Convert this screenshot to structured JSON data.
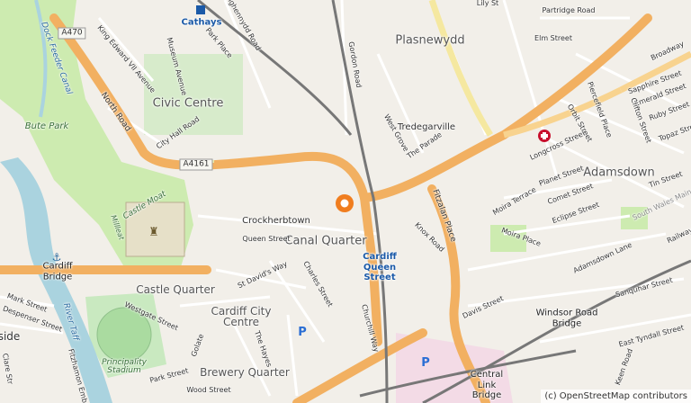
{
  "map": {
    "attribution": "(c) OpenStreetMap contributors",
    "districts": [
      {
        "key": "plasnewydd",
        "text": "Plasnewydd"
      },
      {
        "key": "civic",
        "text": "Civic Centre"
      },
      {
        "key": "adamsdown",
        "text": "Adamsdown"
      },
      {
        "key": "canal",
        "text": "Canal Quarter"
      },
      {
        "key": "castleq",
        "text": "Castle Quarter"
      },
      {
        "key": "citycentre",
        "text": "Cardiff City Centre"
      },
      {
        "key": "brewery",
        "text": "Brewery Quarter"
      },
      {
        "key": "tredegar",
        "text": "Tredegarville"
      },
      {
        "key": "crock",
        "text": "Crockherbtown"
      },
      {
        "key": "side",
        "text": "side"
      }
    ],
    "stations": [
      {
        "key": "cathays",
        "text": "Cathays"
      },
      {
        "key": "queenst",
        "text": "Cardiff Queen Street"
      }
    ],
    "bridges": [
      {
        "key": "cardiffbridge",
        "text": "Cardiff Bridge"
      },
      {
        "key": "windsor",
        "text": "Windsor Road Bridge"
      },
      {
        "key": "central",
        "text": "Central Link Bridge"
      }
    ],
    "parks": [
      {
        "key": "bute",
        "text": "Bute Park"
      },
      {
        "key": "moat",
        "text": "Castle Moat"
      },
      {
        "key": "millleat",
        "text": "Millleat"
      },
      {
        "key": "stadium",
        "text": "Principality Stadium"
      }
    ],
    "water": [
      {
        "key": "feeder",
        "text": "Dock Feeder Canal"
      },
      {
        "key": "taff",
        "text": "River Taff"
      }
    ],
    "shields": [
      {
        "key": "a470",
        "text": "A470"
      },
      {
        "key": "a4161",
        "text": "A4161"
      }
    ],
    "streets": [
      {
        "key": "senghennydd",
        "text": "Senghennydd Road"
      },
      {
        "key": "parkplace",
        "text": "Park Place"
      },
      {
        "key": "kingedward",
        "text": "King Edward VII Avenue"
      },
      {
        "key": "museum",
        "text": "Museum Avenue"
      },
      {
        "key": "northroad",
        "text": "North Road"
      },
      {
        "key": "cityhall",
        "text": "City Hall Road"
      },
      {
        "key": "queenstreet",
        "text": "Queen Street"
      },
      {
        "key": "stdavids",
        "text": "St David's Way"
      },
      {
        "key": "charles",
        "text": "Charles Street"
      },
      {
        "key": "churchill",
        "text": "Churchill Way"
      },
      {
        "key": "westgate",
        "text": "Westgate Street"
      },
      {
        "key": "golate",
        "text": "Golate"
      },
      {
        "key": "thehayes",
        "text": "The Hayes"
      },
      {
        "key": "wood",
        "text": "Wood Street"
      },
      {
        "key": "park",
        "text": "Park Street"
      },
      {
        "key": "gordon",
        "text": "Gordon Road"
      },
      {
        "key": "westgrove",
        "text": "West Grove"
      },
      {
        "key": "parade",
        "text": "The Parade"
      },
      {
        "key": "fitzalan",
        "text": "Fitzalan Place"
      },
      {
        "key": "knox",
        "text": "Knox Road"
      },
      {
        "key": "moiraterr",
        "text": "Moira Terrace"
      },
      {
        "key": "moiraplace",
        "text": "Moira Place"
      },
      {
        "key": "davis",
        "text": "Davis Street"
      },
      {
        "key": "longcross",
        "text": "Longcross Street"
      },
      {
        "key": "planet",
        "text": "Planet Street"
      },
      {
        "key": "comet",
        "text": "Comet Street"
      },
      {
        "key": "eclipse",
        "text": "Eclipse Street"
      },
      {
        "key": "adamsdownlane",
        "text": "Adamsdown Lane"
      },
      {
        "key": "sanquhar",
        "text": "Sanquhar Street"
      },
      {
        "key": "easttyndall",
        "text": "East Tyndall Street"
      },
      {
        "key": "elm",
        "text": "Elm Street"
      },
      {
        "key": "partridge",
        "text": "Partridge Road"
      },
      {
        "key": "broadway",
        "text": "Broadway"
      },
      {
        "key": "sapphire",
        "text": "Sapphire Street"
      },
      {
        "key": "emerald",
        "text": "Emerald Street"
      },
      {
        "key": "ruby",
        "text": "Ruby Street"
      },
      {
        "key": "topaz",
        "text": "Topaz Stre"
      },
      {
        "key": "orbit",
        "text": "Orbit Street"
      },
      {
        "key": "piercefield",
        "text": "Piercefield Place"
      },
      {
        "key": "clifton",
        "text": "Clifton Street"
      },
      {
        "key": "tin",
        "text": "Tin Street"
      },
      {
        "key": "southwales",
        "text": "South Wales Main"
      },
      {
        "key": "railway",
        "text": "Railway"
      },
      {
        "key": "mark",
        "text": "Mark Street"
      },
      {
        "key": "despenser",
        "text": "Despenser Street"
      },
      {
        "key": "fitzhamon",
        "text": "Fitzhamon Emb"
      },
      {
        "key": "clare",
        "text": "Clare Str"
      },
      {
        "key": "keen",
        "text": "Keen Road"
      },
      {
        "key": "lily",
        "text": "Lily St"
      }
    ]
  }
}
